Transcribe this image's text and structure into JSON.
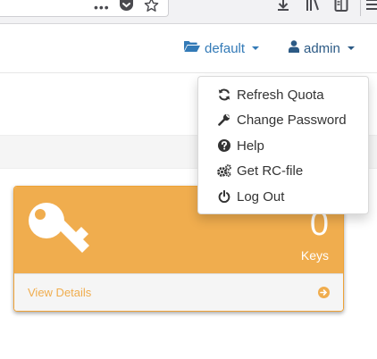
{
  "colors": {
    "warning": "#f0ad4e",
    "link": "#337ab7",
    "navbar_admin": "#2c5a85"
  },
  "browser": {
    "icons": [
      "more-dots-icon",
      "pocket-icon",
      "bookmark-star-icon",
      "download-icon",
      "library-icon",
      "reader-view-icon",
      "menu-icon"
    ]
  },
  "navbar": {
    "project_label": "default",
    "user_label": "admin"
  },
  "user_menu": {
    "items": [
      {
        "label": "Refresh Quota",
        "icon": "refresh-icon"
      },
      {
        "label": "Change Password",
        "icon": "wrench-icon"
      },
      {
        "label": "Help",
        "icon": "question-circle-icon"
      },
      {
        "label": "Get RC-file",
        "icon": "cogs-icon"
      },
      {
        "label": "Log Out",
        "icon": "power-icon"
      }
    ]
  },
  "panel": {
    "icon": "key-icon",
    "count": "0",
    "label": "Keys",
    "footer_link": "View Details",
    "footer_icon": "arrow-circle-right-icon"
  }
}
